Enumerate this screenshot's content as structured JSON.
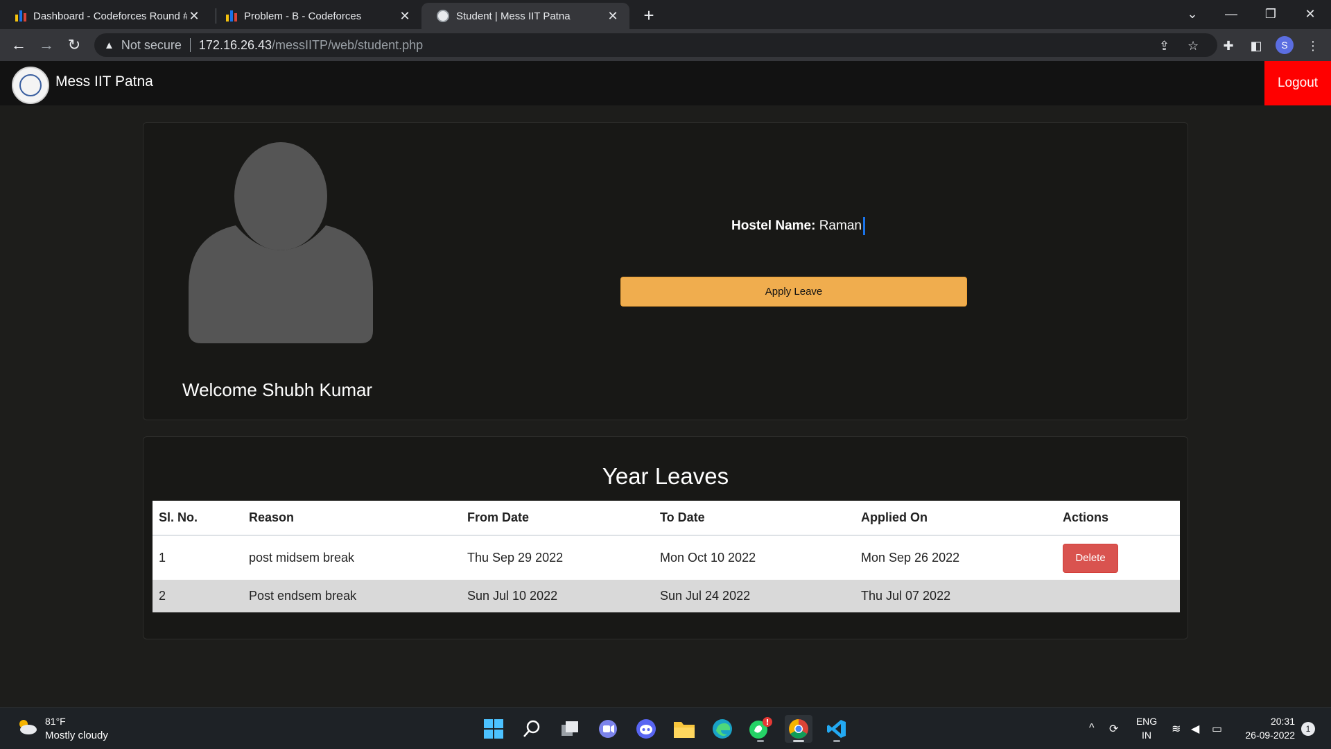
{
  "browser": {
    "tabs": [
      {
        "title": "Dashboard - Codeforces Round #",
        "active": false
      },
      {
        "title": "Problem - B - Codeforces",
        "active": false
      },
      {
        "title": "Student | Mess IIT Patna",
        "active": true
      }
    ],
    "new_tab_label": "+",
    "security_label": "Not secure",
    "url_host": "172.16.26.43",
    "url_path": "/messIITP/web/student.php",
    "profile_initial": "S"
  },
  "navbar": {
    "brand": "Mess IIT Patna",
    "logout_label": "Logout"
  },
  "profile": {
    "welcome": "Welcome Shubh Kumar",
    "hostel_label": "Hostel Name:",
    "hostel_value": "Raman",
    "apply_leave_label": "Apply Leave"
  },
  "leaves": {
    "title": "Year Leaves",
    "columns": [
      "Sl. No.",
      "Reason",
      "From Date",
      "To Date",
      "Applied On",
      "Actions"
    ],
    "rows": [
      {
        "sl": "1",
        "reason": "post midsem break",
        "from": "Thu Sep 29 2022",
        "to": "Mon Oct 10 2022",
        "applied": "Mon Sep 26 2022",
        "action": "Delete"
      },
      {
        "sl": "2",
        "reason": "Post endsem break",
        "from": "Sun Jul 10 2022",
        "to": "Sun Jul 24 2022",
        "applied": "Thu Jul 07 2022",
        "action": ""
      }
    ]
  },
  "taskbar": {
    "weather_temp": "81°F",
    "weather_desc": "Mostly cloudy",
    "lang_top": "ENG",
    "lang_bottom": "IN",
    "time": "20:31",
    "date": "26-09-2022",
    "notification_count": "1",
    "whatsapp_badge": "!"
  },
  "colors": {
    "logout_bg": "#ff0000",
    "apply_bg": "#f0ad4e",
    "delete_bg": "#d9534f"
  }
}
